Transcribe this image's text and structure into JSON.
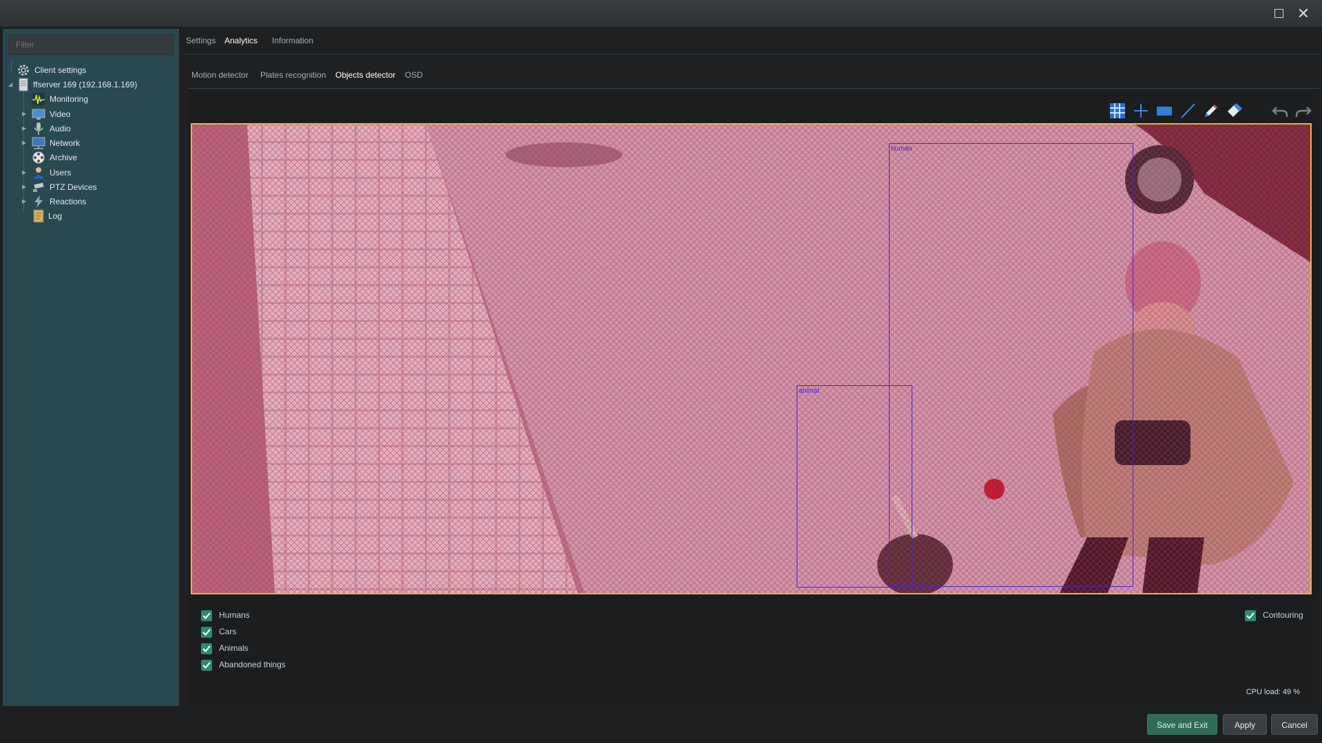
{
  "sidebar": {
    "filter_placeholder": "Filter",
    "items": [
      {
        "label": "Client settings",
        "icon": "gear-icon"
      },
      {
        "label": "ffserver 169 (192.168.1.169)",
        "icon": "server-icon"
      },
      {
        "label": "Monitoring",
        "icon": "pulse-icon"
      },
      {
        "label": "Video",
        "icon": "monitor-icon"
      },
      {
        "label": "Audio",
        "icon": "microphone-icon"
      },
      {
        "label": "Network",
        "icon": "network-icon"
      },
      {
        "label": "Archive",
        "icon": "film-reel-icon"
      },
      {
        "label": "Users",
        "icon": "user-icon"
      },
      {
        "label": "PTZ Devices",
        "icon": "ptz-camera-icon"
      },
      {
        "label": "Reactions",
        "icon": "lightning-icon"
      },
      {
        "label": "Log",
        "icon": "log-icon"
      }
    ]
  },
  "main": {
    "tabs": [
      "Settings",
      "Analytics",
      "Information"
    ],
    "active_tab": "Analytics",
    "subtabs": [
      "Motion detector",
      "Plates recognition",
      "Objects detector",
      "OSD"
    ],
    "active_subtab": "Objects detector"
  },
  "toolbar": [
    "grid-icon",
    "plus-icon",
    "rectangle-icon",
    "line-icon",
    "pencil-icon",
    "eraser-icon",
    "undo-icon",
    "redo-icon"
  ],
  "detections": [
    {
      "label": "human"
    },
    {
      "label": "animal"
    }
  ],
  "checkboxes": [
    {
      "label": "Humans",
      "checked": true
    },
    {
      "label": "Cars",
      "checked": true
    },
    {
      "label": "Animals",
      "checked": true
    },
    {
      "label": "Abandoned things",
      "checked": true
    }
  ],
  "contouring": {
    "label": "Contouring",
    "checked": true
  },
  "cpu_load": "CPU load: 49 %",
  "buttons": {
    "save_exit": "Save and Exit",
    "apply": "Apply",
    "cancel": "Cancel"
  },
  "colors": {
    "accent": "#2d8a72",
    "zone_hatch": "#c0304f",
    "zone_border": "#e6b83a",
    "detection_box": "#4a1fe0",
    "sidebar_bg": "#27494f"
  }
}
